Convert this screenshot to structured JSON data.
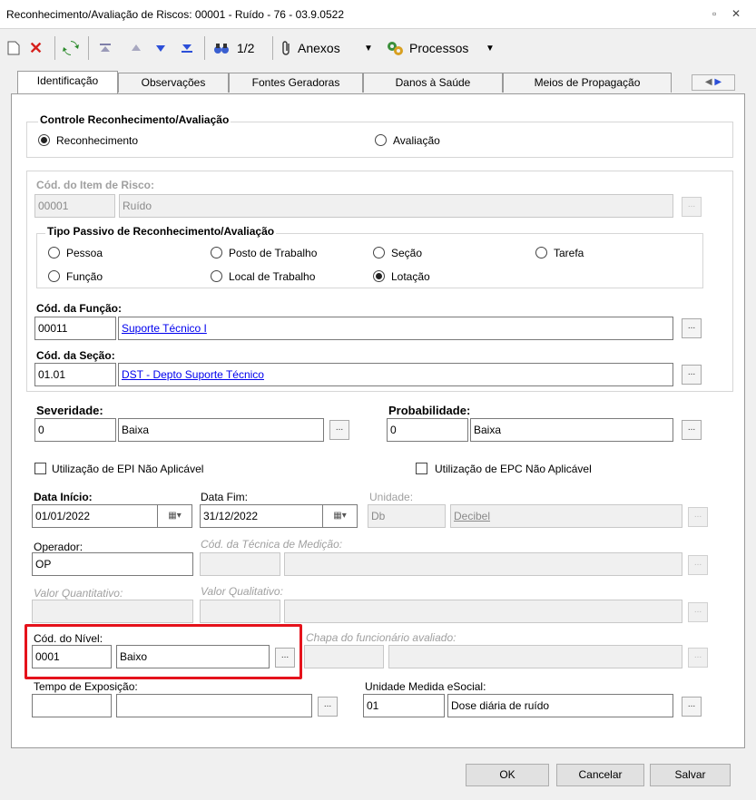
{
  "window": {
    "title": "Reconhecimento/Avaliação de Riscos: 00001 - Ruído - 76 - 03.9.0522",
    "restore_glyph": "▫",
    "close_glyph": "✕"
  },
  "toolbar": {
    "page_indicator": "1/2",
    "anexos_label": "Anexos",
    "processos_label": "Processos"
  },
  "tabs": [
    {
      "label": "Identificação"
    },
    {
      "label": "Observações"
    },
    {
      "label": "Fontes Geradoras"
    },
    {
      "label": "Danos à Saúde"
    },
    {
      "label": "Meios de Propagação"
    }
  ],
  "controle": {
    "title": "Controle Reconhecimento/Avaliação",
    "option_reconhecimento": "Reconhecimento",
    "option_avaliacao": "Avaliação",
    "selected": "Reconhecimento"
  },
  "item_risco": {
    "label": "Cód. do Item de Risco:",
    "code": "00001",
    "description": "Ruído"
  },
  "tipo_passivo": {
    "title": "Tipo Passivo de Reconhecimento/Avaliação",
    "options": [
      "Pessoa",
      "Posto de Trabalho",
      "Seção",
      "Tarefa",
      "Função",
      "Local de Trabalho",
      "Lotação"
    ],
    "selected": "Lotação"
  },
  "funcao": {
    "label": "Cód. da Função:",
    "code": "00011",
    "description": "Suporte Técnico I"
  },
  "secao": {
    "label": "Cód. da Seção:",
    "code": "01.01",
    "description": "DST - Depto Suporte Técnico"
  },
  "severidade": {
    "label": "Severidade:",
    "code": "0",
    "description": "Baixa"
  },
  "probabilidade": {
    "label": "Probabilidade:",
    "code": "0",
    "description": "Baixa"
  },
  "epi_label": "Utilização de EPI Não Aplicável",
  "epc_label": "Utilização de EPC Não Aplicável",
  "data_inicio": {
    "label": "Data Início:",
    "value": "01/01/2022"
  },
  "data_fim": {
    "label": "Data Fim:",
    "value": "31/12/2022"
  },
  "unidade": {
    "label": "Unidade:",
    "code": "Db",
    "description": "Decibel"
  },
  "operador": {
    "label": "Operador:",
    "value": "OP"
  },
  "tecnica_medicao": {
    "label": "Cód. da Técnica de Medição:",
    "code": "",
    "description": ""
  },
  "valor_quantitativo": {
    "label": "Valor Quantitativo:",
    "value": ""
  },
  "valor_qualitativo": {
    "label": "Valor Qualitativo:",
    "code": "",
    "description": ""
  },
  "nivel": {
    "label": "Cód. do Nível:",
    "code": "0001",
    "description": "Baixo"
  },
  "chapa": {
    "label": "Chapa do funcionário avaliado:",
    "code": "",
    "description": ""
  },
  "tempo_exposicao": {
    "label": "Tempo de Exposição:",
    "code": "",
    "description": ""
  },
  "unidade_esocial": {
    "label": "Unidade Medida eSocial:",
    "code": "01",
    "description": "Dose diária de ruído"
  },
  "buttons": {
    "ok": "OK",
    "cancelar": "Cancelar",
    "salvar": "Salvar"
  },
  "ellipsis": "...",
  "colors": {
    "highlight": "#e5121b",
    "link": "#0000ee"
  }
}
